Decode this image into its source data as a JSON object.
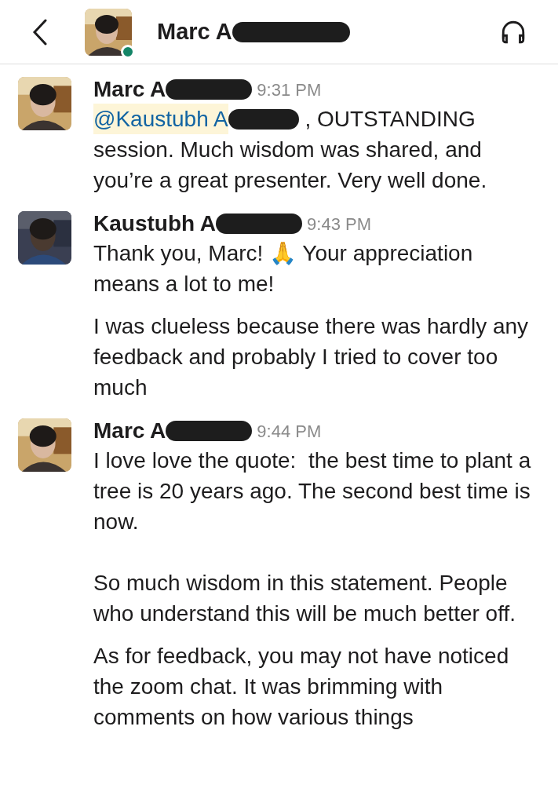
{
  "header": {
    "name": "Marc A",
    "online": true
  },
  "messages": [
    {
      "author": "Marc A",
      "time": "9:31 PM",
      "paragraphs": [
        {
          "mention": "@Kaustubh A",
          "text": " , OUTSTANDING session. Much wisdom was shared, and you’re a great presenter. Very well done."
        }
      ]
    },
    {
      "author": "Kaustubh A",
      "time": "9:43 PM",
      "paragraphs": [
        {
          "text": "Thank you, Marc! 🙏 Your appreciation means a lot to me!"
        },
        {
          "text": "I was clueless because there was hardly any feedback and probably I tried to cover too much"
        }
      ]
    },
    {
      "author": "Marc A",
      "time": "9:44 PM",
      "paragraphs": [
        {
          "text": "I love love the quote:  the best time to plant a tree is 20 years ago. The second best time is now.\n\nSo much wisdom in this statement. People who understand this will be much better off."
        },
        {
          "text": "As for feedback, you may not have noticed the zoom chat. It was brimming with comments on how various things"
        }
      ]
    }
  ]
}
